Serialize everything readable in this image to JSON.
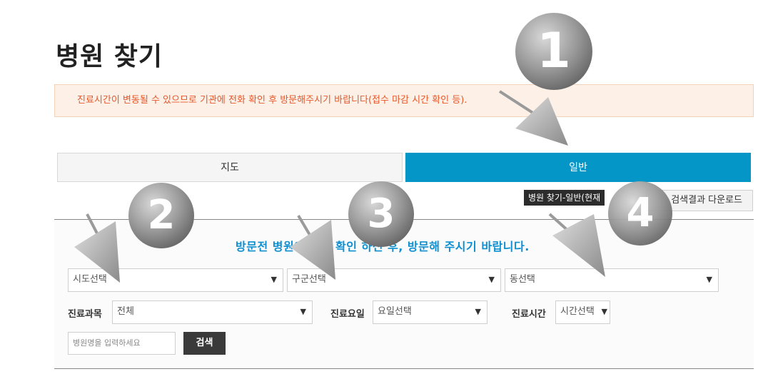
{
  "page": {
    "title": "병원 찾기"
  },
  "notice": {
    "text": "진료시간이 변동될 수 있으므로 기관에 전화 확인 후 방문해주시기 바랍니다(접수 마감 시간 확인 등)."
  },
  "tabs": [
    {
      "label": "지도",
      "active": false
    },
    {
      "label": "일반",
      "active": true
    }
  ],
  "tooltip": {
    "text": "병원 찾기-일반(현재"
  },
  "download": {
    "label": "검색결과 다운로드"
  },
  "search": {
    "heading": "방문전 병원에 정보 확인 하신 후, 방문해 주시기 바랍니다.",
    "sido": "시도선택",
    "gugun": "구군선택",
    "dong": "동선택",
    "dept_label": "진료과목",
    "dept_value": "전체",
    "day_label": "진료요일",
    "day_value": "요일선택",
    "time_label": "진료시간",
    "time_value": "시간선택",
    "name_placeholder": "병원명을 입력하세요",
    "submit_label": "검색"
  },
  "callouts": [
    "1",
    "2",
    "3",
    "4"
  ],
  "colors": {
    "accent": "#0596c8",
    "notice_text": "#e8562a",
    "notice_bg": "#fdf1e7"
  }
}
